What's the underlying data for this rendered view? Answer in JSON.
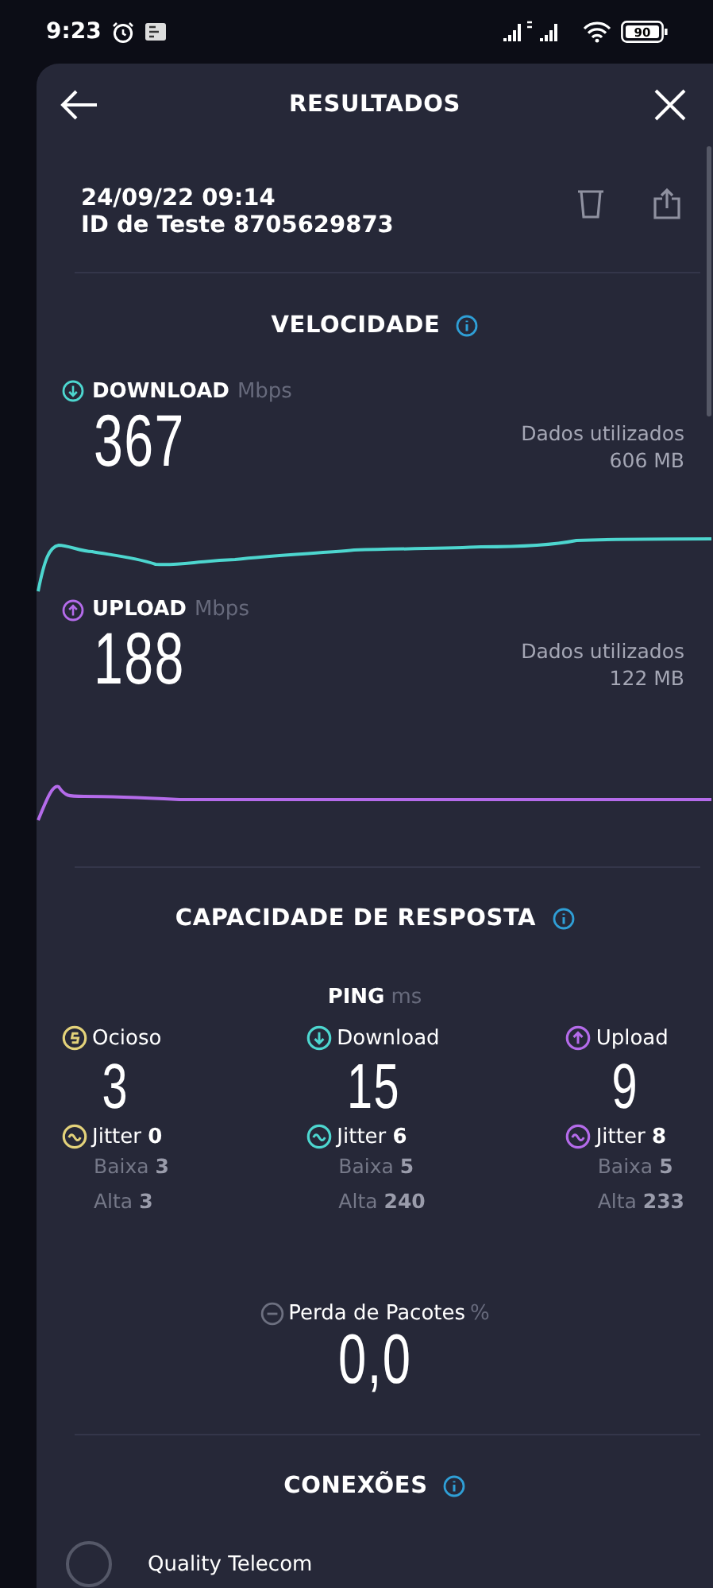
{
  "status_bar": {
    "time": "9:23",
    "battery": "90"
  },
  "header": {
    "title": "RESULTADOS"
  },
  "result": {
    "datetime": "24/09/22 09:14",
    "test_id": "ID de Teste 8705629873"
  },
  "speed": {
    "title": "VELOCIDADE",
    "items": [
      {
        "kind": "download",
        "label": "DOWNLOAD",
        "unit": "Mbps",
        "value": "367",
        "data_label": "Dados utilizados",
        "data_value": "606 MB"
      },
      {
        "kind": "upload",
        "label": "UPLOAD",
        "unit": "Mbps",
        "value": "188",
        "data_label": "Dados utilizados",
        "data_value": "122 MB"
      }
    ]
  },
  "responsiveness": {
    "title": "CAPACIDADE DE RESPOSTA",
    "ping_label": "PING",
    "ping_unit": "ms",
    "columns": [
      {
        "kind": "idle",
        "label": "Ocioso",
        "value": "3",
        "jitter_label": "Jitter",
        "jitter": "0",
        "low_label": "Baixa",
        "low": "3",
        "high_label": "Alta",
        "high": "3"
      },
      {
        "kind": "download",
        "label": "Download",
        "value": "15",
        "jitter_label": "Jitter",
        "jitter": "6",
        "low_label": "Baixa",
        "low": "5",
        "high_label": "Alta",
        "high": "240"
      },
      {
        "kind": "upload",
        "label": "Upload",
        "value": "9",
        "jitter_label": "Jitter",
        "jitter": "8",
        "low_label": "Baixa",
        "low": "5",
        "high_label": "Alta",
        "high": "233"
      }
    ],
    "packet_loss": {
      "label": "Perda de Pacotes",
      "unit": "%",
      "value": "0,0"
    }
  },
  "connections": {
    "title": "CONEXÕES",
    "provider": "Quality Telecom"
  }
}
